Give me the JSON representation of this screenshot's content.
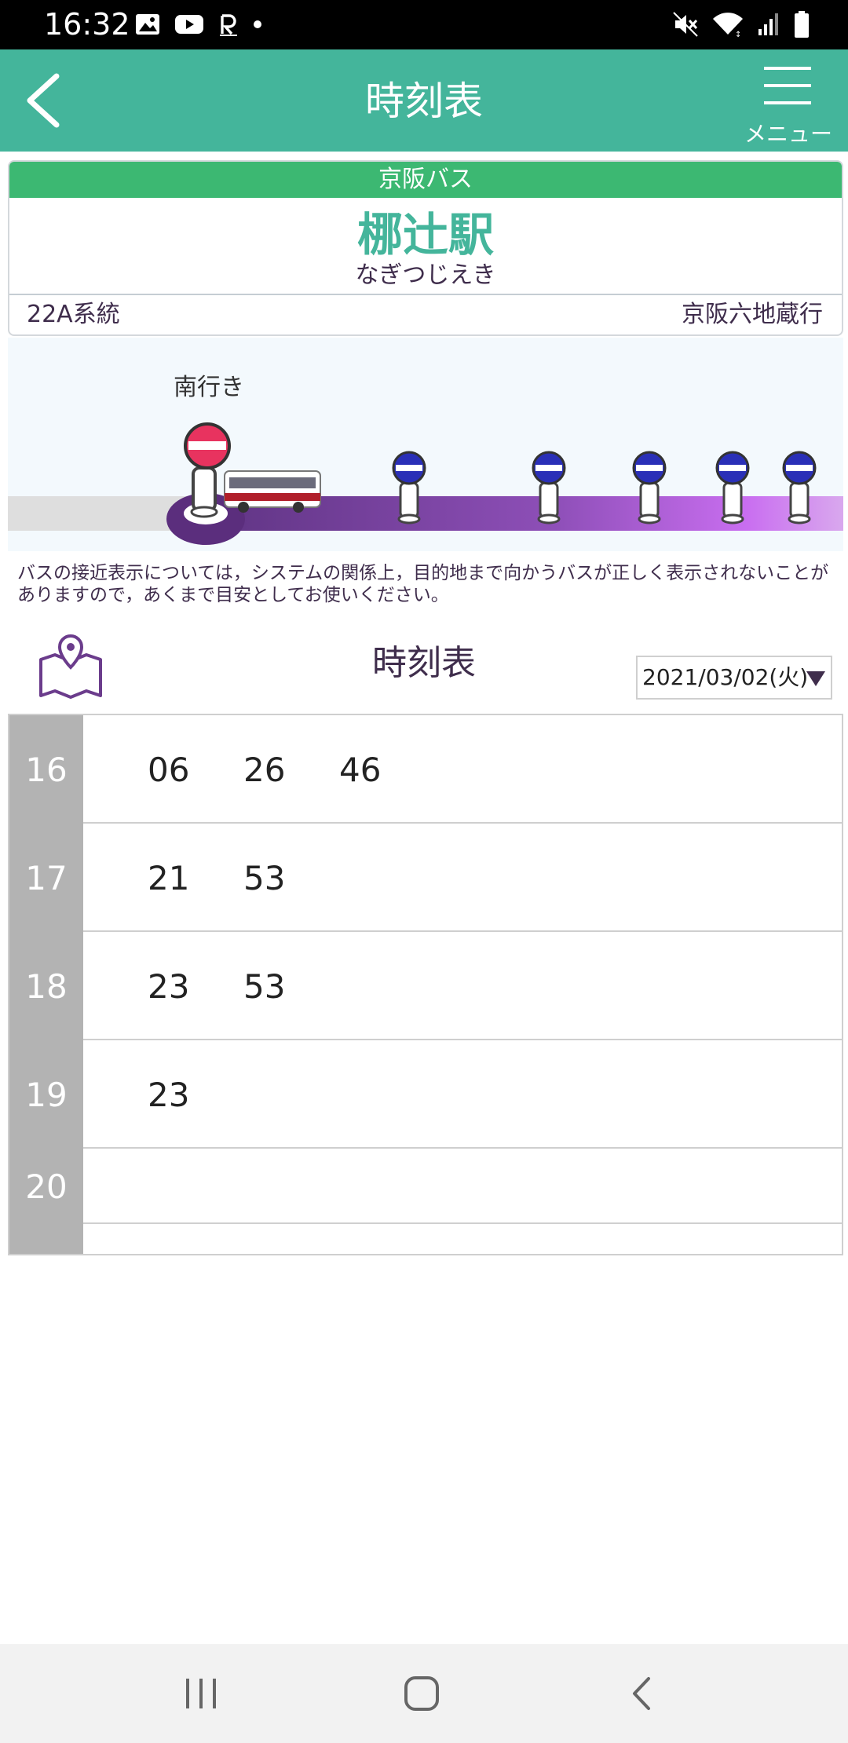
{
  "status_bar": {
    "time": "16:32",
    "left_icons": [
      "gallery-icon",
      "youtube-icon",
      "rakuten-icon",
      "dot-icon"
    ],
    "right_icons": [
      "mute-icon",
      "wifi-icon",
      "signal-icon",
      "battery-icon"
    ]
  },
  "header": {
    "title": "時刻表",
    "menu_label": "メニュー"
  },
  "stop": {
    "operator": "京阪バス",
    "name": "梛辻駅",
    "kana": "なぎつじえき",
    "route_number": "22A系統",
    "destination": "京阪六地蔵行"
  },
  "route_map": {
    "direction": "南行き",
    "colors": {
      "current_stop": "#e8335f",
      "other_stop": "#2a2fb7",
      "track": "#6f3f8f",
      "track_end": "#d6a6ee"
    }
  },
  "notice": "バスの接近表示については，システムの関係上，目的地まで向かうバスが正しく表示されないことがありますので，あくまで目安としてお使いください。",
  "timetable": {
    "title": "時刻表",
    "date": "2021/03/02(火)",
    "rows": [
      {
        "hour": "16",
        "minutes": [
          "06",
          "26",
          "46"
        ]
      },
      {
        "hour": "17",
        "minutes": [
          "21",
          "53"
        ]
      },
      {
        "hour": "18",
        "minutes": [
          "23",
          "53"
        ]
      },
      {
        "hour": "19",
        "minutes": [
          "23"
        ]
      },
      {
        "hour": "20",
        "minutes": []
      }
    ]
  },
  "colors": {
    "header": "#44b59b",
    "operator_bar": "#3cb872",
    "hour_column": "#b3b3b3",
    "text_purple": "#3f2d4c"
  }
}
